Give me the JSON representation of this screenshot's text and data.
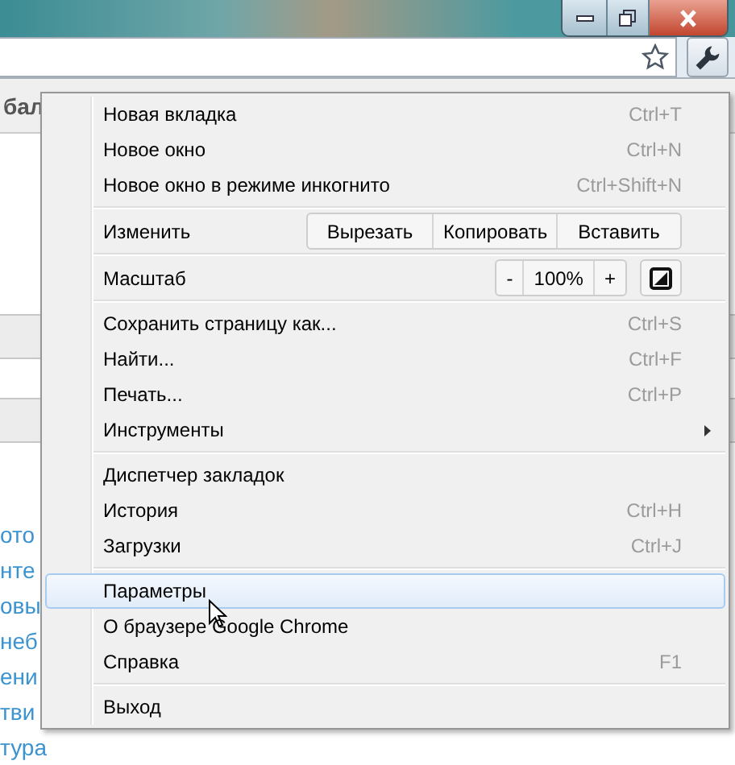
{
  "page": {
    "heading_fragment": "бал",
    "link_fragments": [
      "ото",
      "нте",
      "овы",
      "неб",
      "ени",
      "тви",
      "тура"
    ]
  },
  "menu": {
    "items": [
      {
        "kind": "item",
        "label": "Новая вкладка",
        "shortcut": "Ctrl+T",
        "selected": false,
        "submenu": false
      },
      {
        "kind": "item",
        "label": "Новое окно",
        "shortcut": "Ctrl+N",
        "selected": false,
        "submenu": false
      },
      {
        "kind": "item",
        "label": "Новое окно в режиме инкогнито",
        "shortcut": "Ctrl+Shift+N",
        "selected": false,
        "submenu": false
      },
      {
        "kind": "separator"
      },
      {
        "kind": "edit",
        "label": "Изменить",
        "buttons": [
          "Вырезать",
          "Копировать",
          "Вставить"
        ]
      },
      {
        "kind": "separator"
      },
      {
        "kind": "zoom",
        "label": "Масштаб",
        "minus": "-",
        "value": "100%",
        "plus": "+"
      },
      {
        "kind": "separator"
      },
      {
        "kind": "item",
        "label": "Сохранить страницу как...",
        "shortcut": "Ctrl+S",
        "selected": false,
        "submenu": false
      },
      {
        "kind": "item",
        "label": "Найти...",
        "shortcut": "Ctrl+F",
        "selected": false,
        "submenu": false
      },
      {
        "kind": "item",
        "label": "Печать...",
        "shortcut": "Ctrl+P",
        "selected": false,
        "submenu": false
      },
      {
        "kind": "item",
        "label": "Инструменты",
        "selected": false,
        "submenu": true
      },
      {
        "kind": "separator"
      },
      {
        "kind": "item",
        "label": "Диспетчер закладок",
        "selected": false,
        "submenu": false
      },
      {
        "kind": "item",
        "label": "История",
        "shortcut": "Ctrl+H",
        "selected": false,
        "submenu": false
      },
      {
        "kind": "item",
        "label": "Загрузки",
        "shortcut": "Ctrl+J",
        "selected": false,
        "submenu": false
      },
      {
        "kind": "separator"
      },
      {
        "kind": "item",
        "label": "Параметры",
        "selected": true,
        "submenu": false
      },
      {
        "kind": "item",
        "label": "О браузере Google Chrome",
        "selected": false,
        "submenu": false
      },
      {
        "kind": "item",
        "label": "Справка",
        "shortcut": "F1",
        "selected": false,
        "submenu": false
      },
      {
        "kind": "separator"
      },
      {
        "kind": "item",
        "label": "Выход",
        "selected": false,
        "submenu": false
      }
    ]
  }
}
